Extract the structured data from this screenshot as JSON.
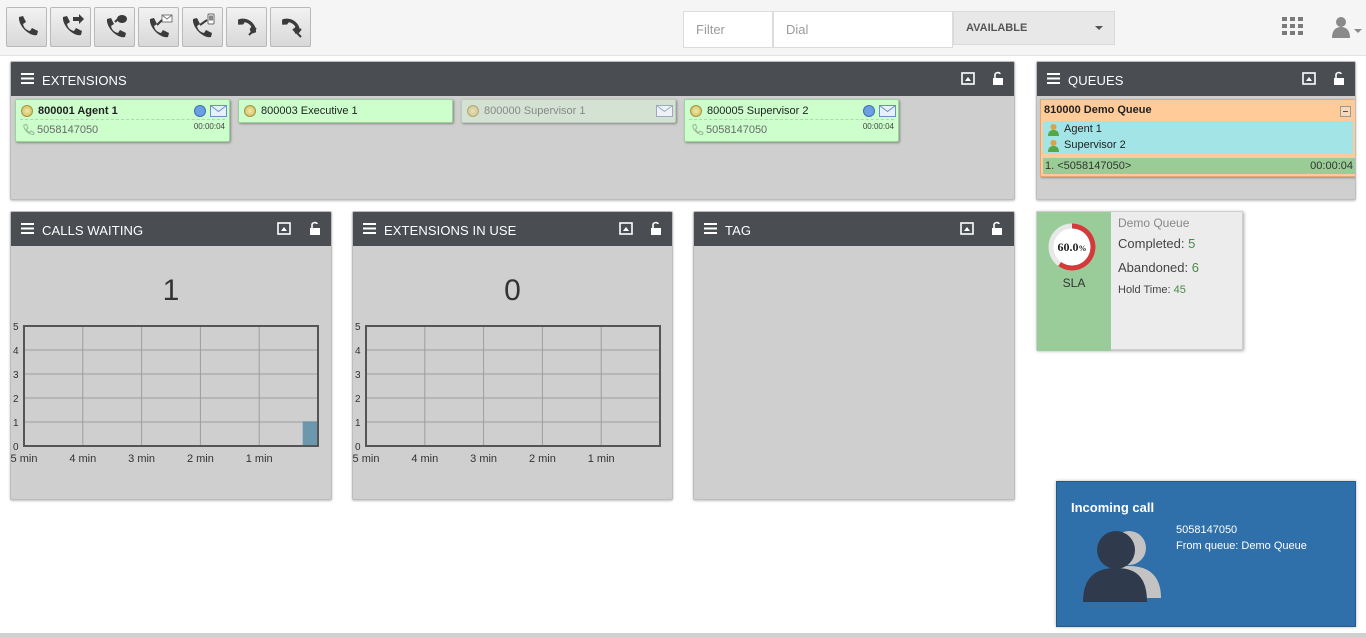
{
  "toolbar": {
    "buttons": [
      {
        "name": "call-button",
        "icon": "phone-icon"
      },
      {
        "name": "transfer-button",
        "icon": "phone-forward-icon"
      },
      {
        "name": "conference-button",
        "icon": "phone-conference-icon"
      },
      {
        "name": "voicemail-button",
        "icon": "phone-mail-icon"
      },
      {
        "name": "mobile-button",
        "icon": "phone-mobile-icon"
      },
      {
        "name": "pickup-button",
        "icon": "phone-pickup-icon"
      },
      {
        "name": "hangup-button",
        "icon": "phone-hangup-icon"
      }
    ],
    "filter_placeholder": "Filter",
    "dial_placeholder": "Dial",
    "status": "AVAILABLE"
  },
  "extensions_panel": {
    "title": "EXTENSIONS",
    "items": [
      {
        "label": "800001 Agent 1",
        "number": "5058147050",
        "duration": "00:00:04"
      },
      {
        "label": "800003 Executive 1"
      },
      {
        "label": "800000 Supervisor 1"
      },
      {
        "label": "800005 Supervisor 2",
        "number": "5058147050",
        "duration": "00:00:04"
      }
    ]
  },
  "queues_panel": {
    "title": "QUEUES",
    "queue": {
      "name": "810000 Demo Queue",
      "members": [
        "Agent 1",
        "Supervisor 2"
      ],
      "waiting_caller": "1. <5058147050>",
      "waiting_time": "00:00:04"
    }
  },
  "calls_waiting_panel": {
    "title": "CALLS WAITING",
    "value": "1"
  },
  "extensions_in_use_panel": {
    "title": "EXTENSIONS IN USE",
    "value": "0"
  },
  "tag_panel": {
    "title": "TAG"
  },
  "chart_data": [
    {
      "type": "area",
      "x": [
        "5 min",
        "4 min",
        "3 min",
        "2 min",
        "1 min"
      ],
      "ytick_labels": [
        "0",
        "1",
        "2",
        "3",
        "4",
        "5"
      ],
      "ylim": [
        0,
        5
      ],
      "values": [
        0,
        0,
        0,
        0,
        0,
        0,
        0,
        0,
        0,
        0,
        0,
        0,
        0,
        0,
        0,
        0,
        0,
        0,
        0,
        1
      ],
      "color": "#5a8fa6"
    },
    {
      "type": "area",
      "x": [
        "5 min",
        "4 min",
        "3 min",
        "2 min",
        "1 min"
      ],
      "ytick_labels": [
        "0",
        "1",
        "2",
        "3",
        "4",
        "5"
      ],
      "ylim": [
        0,
        5
      ],
      "values": [
        0,
        0,
        0,
        0,
        0,
        0,
        0,
        0,
        0,
        0,
        0,
        0,
        0,
        0,
        0,
        0,
        0,
        0,
        0,
        0
      ],
      "color": "#5a8fa6"
    }
  ],
  "sla": {
    "percent_value": 60.0,
    "percent": "60.0",
    "percent_sign": "%",
    "label": "SLA",
    "queue_name": "Demo Queue",
    "completed_label": "Completed:",
    "completed": "5",
    "abandoned_label": "Abandoned:",
    "abandoned": "6",
    "hold_label": "Hold Time:",
    "hold": "45"
  },
  "incoming_call": {
    "title": "Incoming call",
    "number": "5058147050",
    "from": "From queue: Demo Queue"
  },
  "colors": {
    "panel_header": "#4a4d52",
    "extension_ok": "#ccffcc",
    "queue_bg": "#ffcc99",
    "incoming_bg": "#2f6faa",
    "sla_green": "#99cc99",
    "sla_ring": "#d33b3b"
  }
}
